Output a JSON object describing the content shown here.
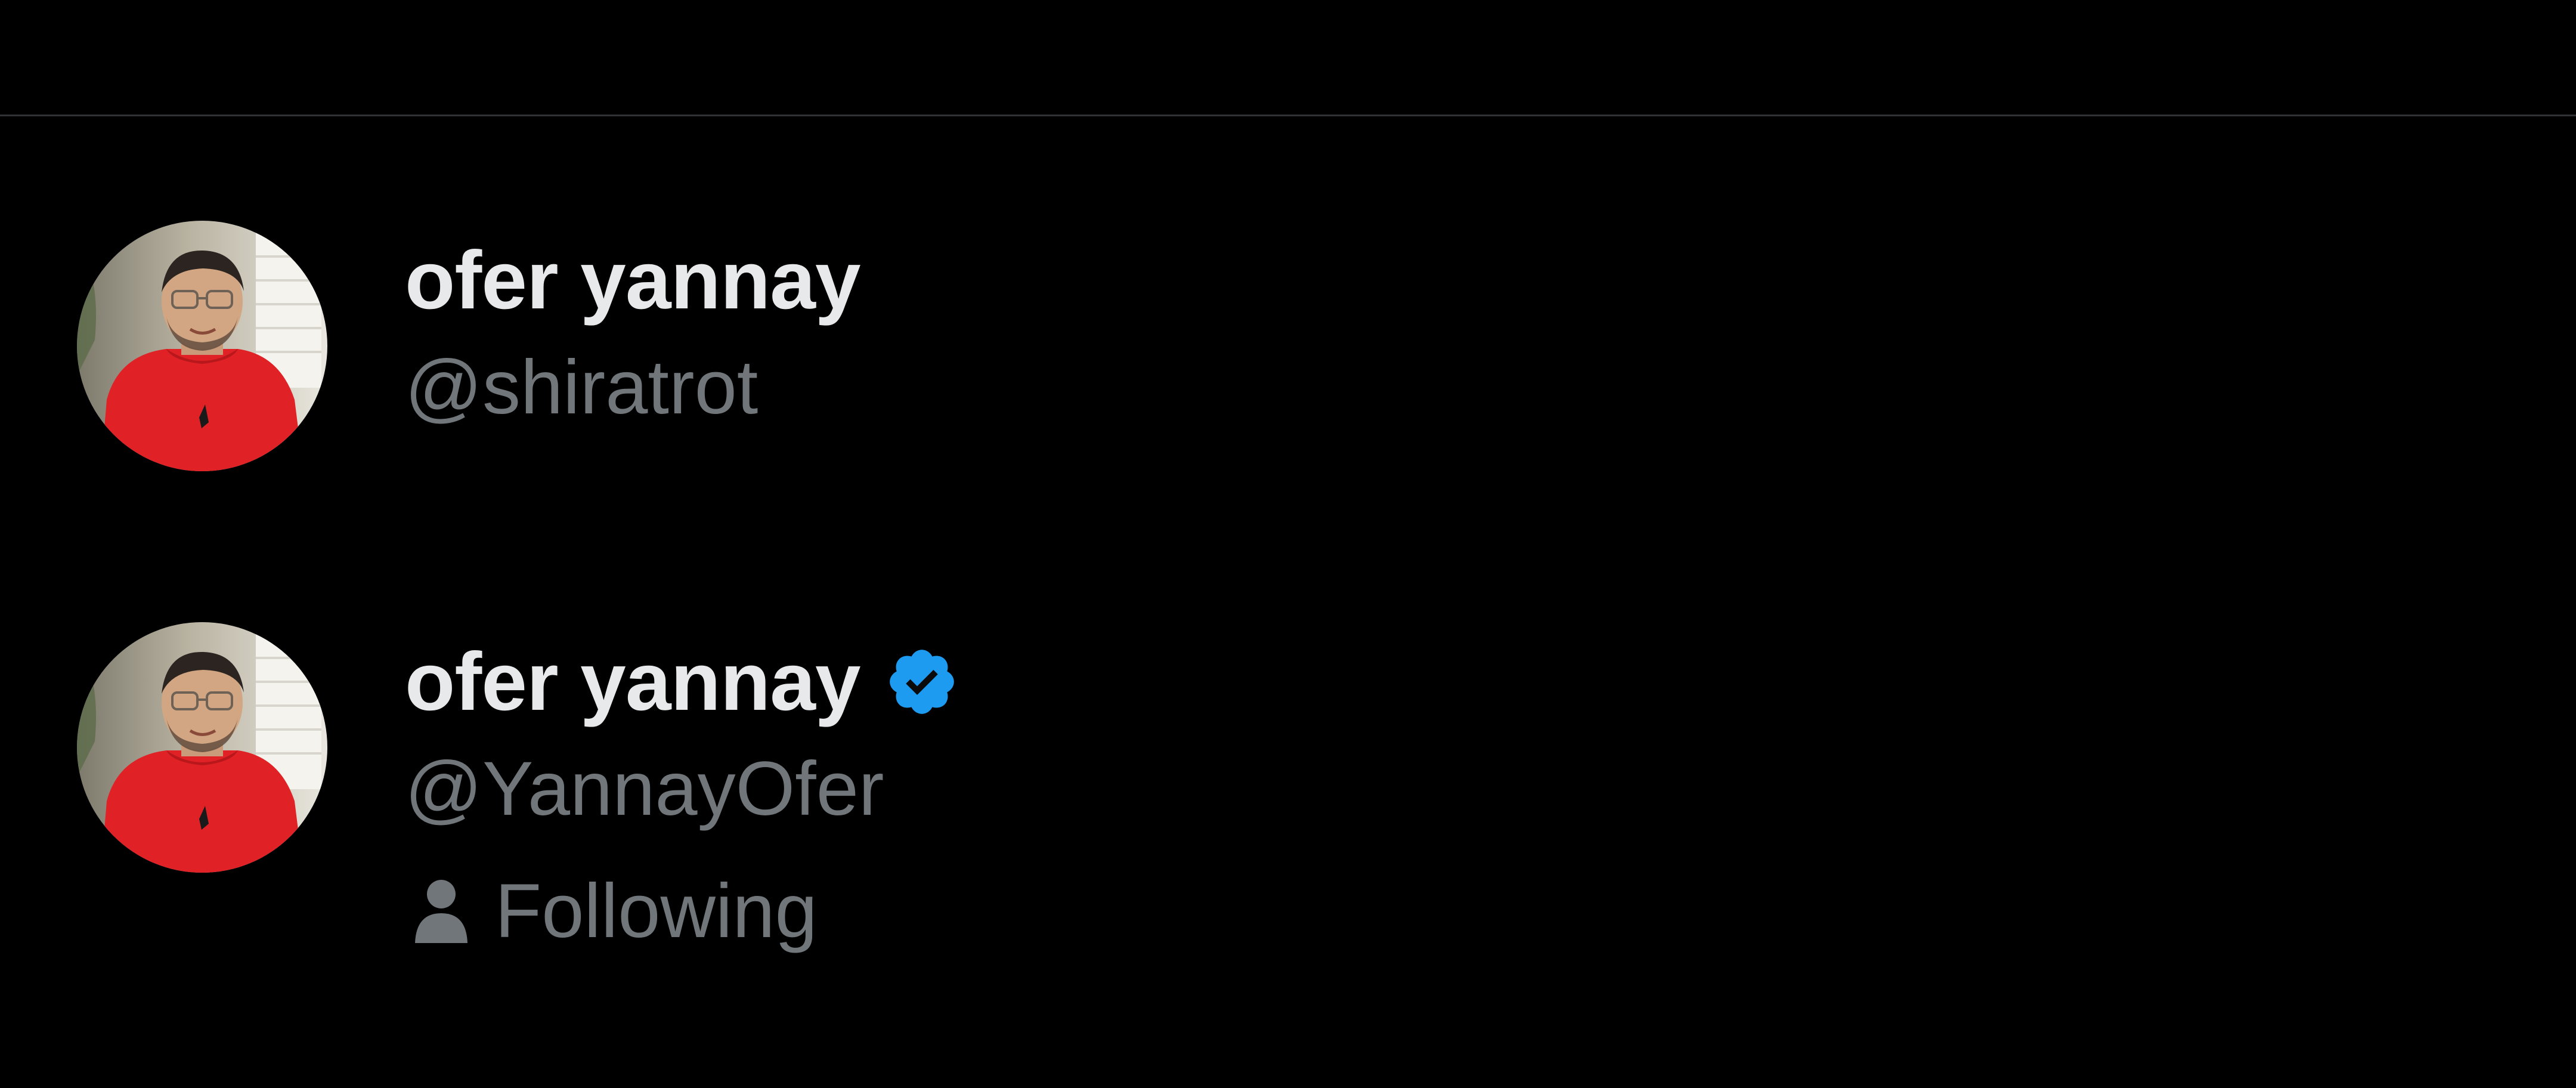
{
  "accounts": [
    {
      "display_name": "ofer yannay",
      "handle": "@shiratrot",
      "verified": false,
      "avatar_icon": "profile-photo"
    },
    {
      "display_name": "ofer yannay",
      "handle": "@YannayOfer",
      "verified": true,
      "verified_icon": "verified-badge-icon",
      "status_icon": "person-icon",
      "status_label": "Following",
      "avatar_icon": "profile-photo"
    }
  ],
  "colors": {
    "background": "#000000",
    "name_text": "#e7e9ea",
    "secondary_text": "#71767b",
    "verified_blue": "#1d9bf0",
    "divider": "#2f3336"
  }
}
